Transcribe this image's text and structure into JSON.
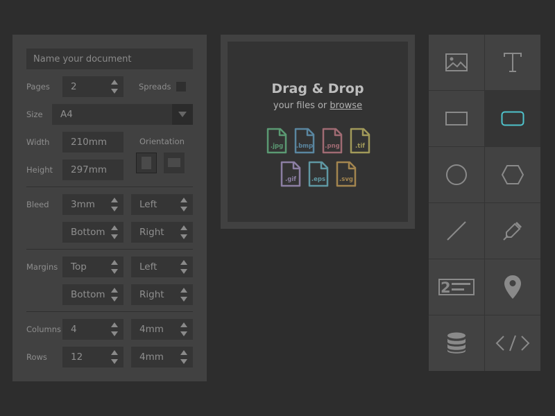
{
  "form": {
    "doc_name_placeholder": "Name your document",
    "pages_label": "Pages",
    "pages_value": "2",
    "spreads_label": "Spreads",
    "size_label": "Size",
    "size_value": "A4",
    "width_label": "Width",
    "width_value": "210mm",
    "height_label": "Height",
    "height_value": "297mm",
    "orientation_label": "Orientation",
    "bleed_label": "Bleed",
    "bleed_value": "3mm",
    "bleed_side1": "Left",
    "bleed_side2": "Bottom",
    "bleed_side3": "Right",
    "margins_label": "Margins",
    "margins_side1": "Top",
    "margins_side2": "Left",
    "margins_side3": "Bottom",
    "margins_side4": "Right",
    "columns_label": "Columns",
    "columns_value": "4",
    "columns_gutter": "4mm",
    "rows_label": "Rows",
    "rows_value": "12",
    "rows_gutter": "4mm"
  },
  "dropzone": {
    "title": "Drag & Drop",
    "subtitle_prefix": "your files or ",
    "subtitle_link": "browse",
    "file_types": [
      {
        "ext": ".jpg",
        "color": "#5b9a73"
      },
      {
        "ext": ".bmp",
        "color": "#5a86a0"
      },
      {
        "ext": ".png",
        "color": "#a06b73"
      },
      {
        "ext": ".tif",
        "color": "#a29a5a"
      },
      {
        "ext": ".gif",
        "color": "#8c7fa3"
      },
      {
        "ext": ".eps",
        "color": "#5f98a3"
      },
      {
        "ext": ".svg",
        "color": "#a3854f"
      }
    ]
  },
  "tools": {
    "accent_color": "#4fc3cc",
    "icon_color": "#8a8a8a",
    "items": [
      "image-icon",
      "text-icon",
      "rectangle-icon",
      "rounded-rectangle-icon",
      "circle-icon",
      "hexagon-icon",
      "line-icon",
      "pen-icon",
      "numbered-list-icon",
      "map-pin-icon",
      "database-icon",
      "code-icon"
    ]
  }
}
